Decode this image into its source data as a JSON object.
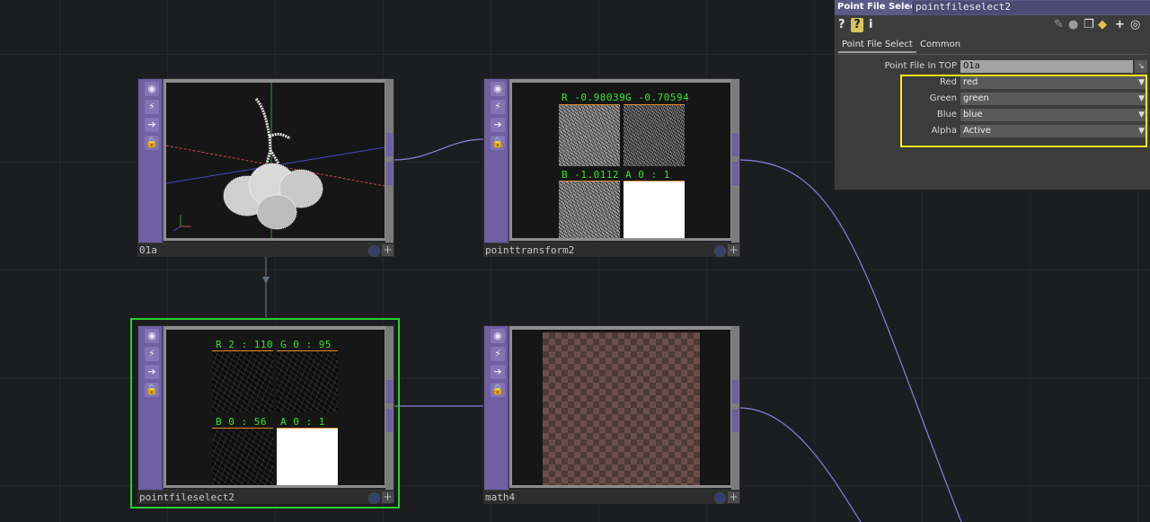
{
  "nodes": {
    "n01a": {
      "name": "01a"
    },
    "pointtransform2": {
      "name": "pointtransform2",
      "channels": {
        "r": "R -0.98039",
        "g": "G -0.70594",
        "b": "B -1.0112",
        "a": "A 0 : 1"
      }
    },
    "pointfileselect2": {
      "name": "pointfileselect2",
      "channels": {
        "r": "R 2 : 110",
        "g": "G 0 : 95",
        "b": "B 0 : 56",
        "a": "A 0 : 1"
      }
    },
    "math4": {
      "name": "math4"
    }
  },
  "panel": {
    "op_type": "Point File Select",
    "op_name": "pointfileselect2",
    "tabs": [
      "Point File Select",
      "Common"
    ],
    "params": {
      "point_file_in_top": {
        "label": "Point File In TOP",
        "value": "01a"
      },
      "red": {
        "label": "Red",
        "value": "red"
      },
      "green": {
        "label": "Green",
        "value": "green"
      },
      "blue": {
        "label": "Blue",
        "value": "blue"
      },
      "alpha": {
        "label": "Alpha",
        "value": "Active"
      }
    }
  },
  "colors": {
    "selection": "#29cf2d",
    "highlight": "#f2f21a",
    "wire": "#8c7fe0"
  }
}
